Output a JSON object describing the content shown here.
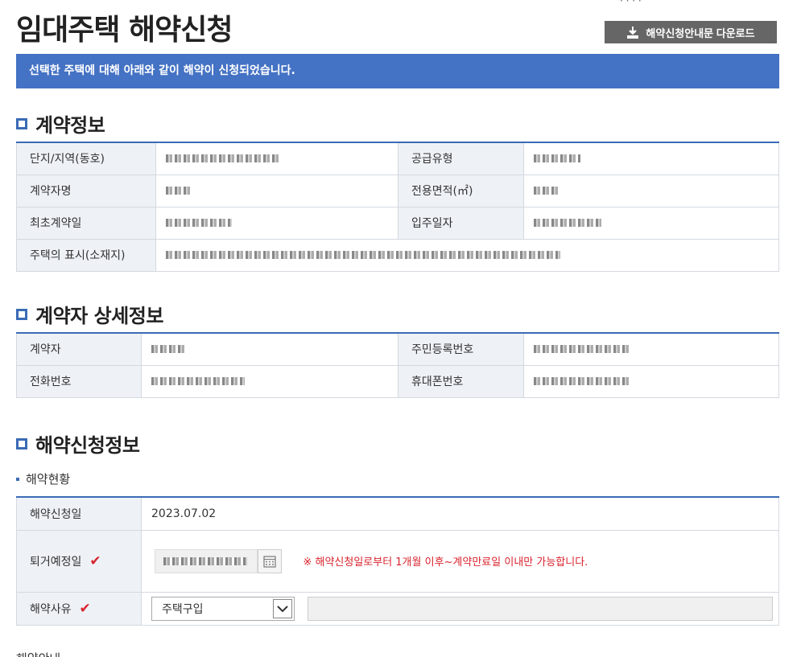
{
  "page": {
    "title": "임대주택 해약신청",
    "download_label": "해약신청안내문 다운로드",
    "notice": "선택한 주택에 대해 아래와 같이 해약이 신청되었습니다."
  },
  "contract": {
    "section_title": "계약정보",
    "labels": {
      "complex": "단지/지역(동호)",
      "supply_type": "공급유형",
      "contractor_name": "계약자명",
      "area": "전용면적(㎡)",
      "first_contract_date": "최초계약일",
      "move_in_date": "입주일자",
      "address": "주택의 표시(소재지)"
    }
  },
  "contractor": {
    "section_title": "계약자 상세정보",
    "labels": {
      "contractor": "계약자",
      "resident_no": "주민등록번호",
      "phone": "전화번호",
      "mobile": "휴대폰번호"
    }
  },
  "cancellation": {
    "section_title": "해약신청정보",
    "subtitle": "해약현황",
    "labels": {
      "apply_date": "해약신청일",
      "move_out_date": "퇴거예정일",
      "reason": "해약사유"
    },
    "apply_date_value": "2023.07.02",
    "move_out_warning": "※ 해약신청일로부터 1개월 이후~계약만료일 이내만 가능합니다.",
    "reason_selected": "주택구입",
    "required_mark": "✔"
  },
  "footer_cut_text": "해약안내"
}
